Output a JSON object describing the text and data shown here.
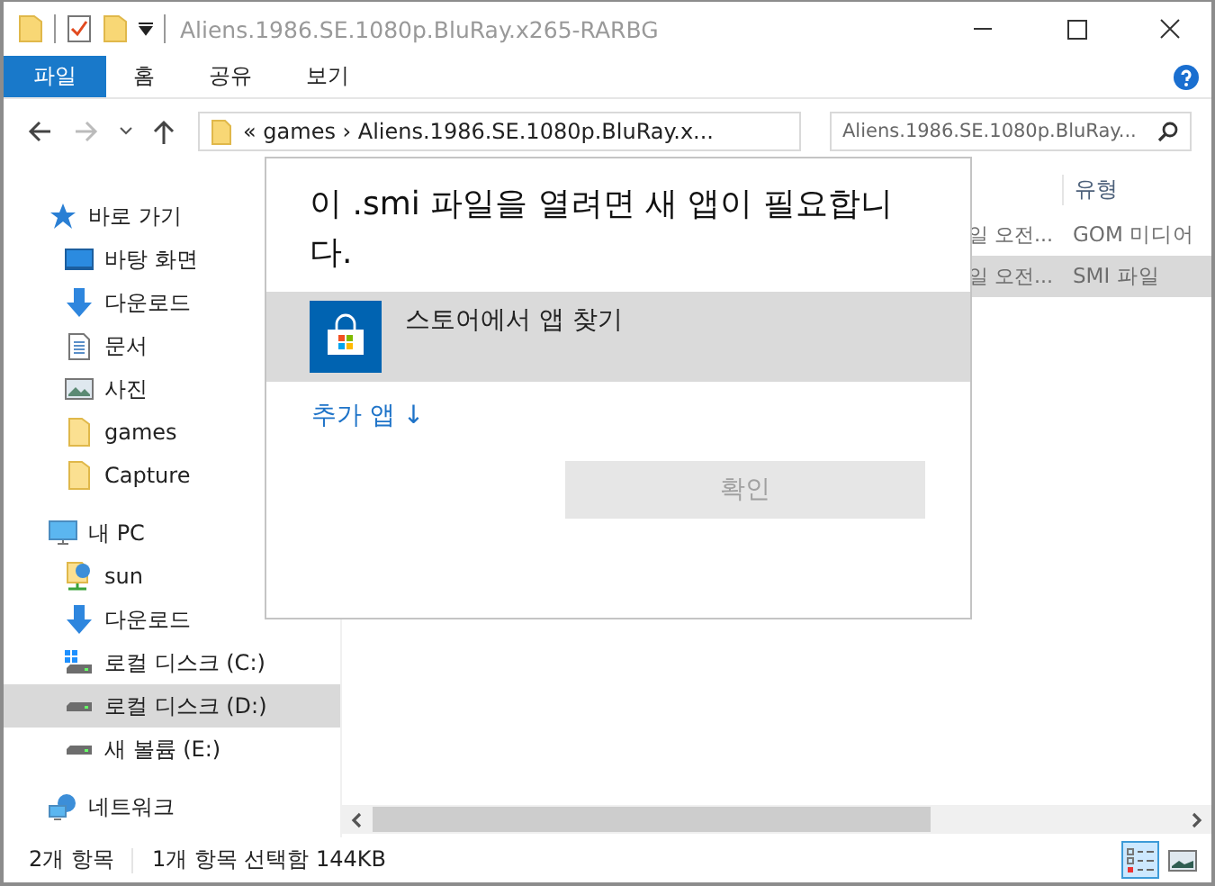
{
  "window": {
    "title": "Aliens.1986.SE.1080p.BluRay.x265-RARBG"
  },
  "ribbon_tabs": [
    {
      "label": "파일",
      "kind": "file"
    },
    {
      "label": "홈",
      "kind": "tab"
    },
    {
      "label": "공유",
      "kind": "tab"
    },
    {
      "label": "보기",
      "kind": "tab"
    }
  ],
  "address_bar": {
    "path": "«  games  ›  Aliens.1986.SE.1080p.BluRay.x..."
  },
  "search": {
    "placeholder": "Aliens.1986.SE.1080p.BluRay..."
  },
  "sidebar": {
    "items": [
      {
        "label": "바로 가기",
        "kind": "star",
        "selected": false,
        "children": [
          {
            "label": "바탕 화면",
            "kind": "desktop",
            "selected": false
          },
          {
            "label": "다운로드",
            "kind": "download",
            "selected": false
          },
          {
            "label": "문서",
            "kind": "document",
            "selected": false
          },
          {
            "label": "사진",
            "kind": "pictures",
            "selected": false
          },
          {
            "label": "games",
            "kind": "folder",
            "selected": false
          },
          {
            "label": "Capture",
            "kind": "folder",
            "selected": false
          }
        ]
      },
      {
        "label": "내 PC",
        "kind": "pc",
        "selected": false,
        "children": [
          {
            "label": "sun",
            "kind": "netfolder",
            "selected": false
          },
          {
            "label": "다운로드",
            "kind": "download",
            "selected": false
          },
          {
            "label": "로컬 디스크 (C:)",
            "kind": "windrive",
            "selected": false
          },
          {
            "label": "로컬 디스크 (D:)",
            "kind": "drive",
            "selected": true
          },
          {
            "label": "새 볼륨 (E:)",
            "kind": "drive",
            "selected": false
          }
        ]
      },
      {
        "label": "네트워크",
        "kind": "network",
        "selected": false
      }
    ]
  },
  "table": {
    "columns": [
      "유형"
    ],
    "rows": [
      {
        "column_1": "일 오전...",
        "type": "GOM 미디어",
        "selected": false
      },
      {
        "column_1": "일 오전...",
        "type": "SMI 파일",
        "selected": true
      }
    ]
  },
  "dialog": {
    "title": "이 .smi 파일을 열려면 새 앱이 필요합니다.",
    "store_option": "스토어에서 앱 찾기",
    "more_apps": "추가 앱 ↓",
    "ok_button": "확인",
    "ok_disabled": true
  },
  "status_bar": {
    "item_count": "2개 항목",
    "selection": "1개 항목 선택함 144KB",
    "view_buttons": [
      {
        "kind": "details",
        "selected": true
      },
      {
        "kind": "large",
        "selected": false
      }
    ]
  }
}
